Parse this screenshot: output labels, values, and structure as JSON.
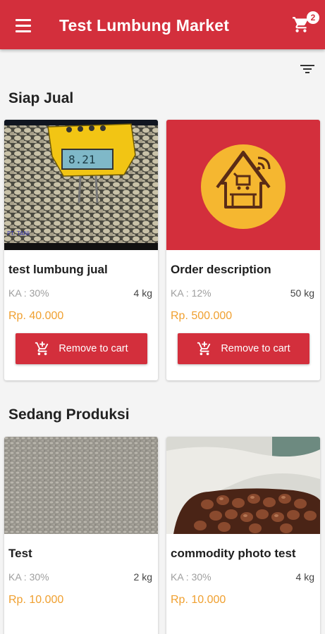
{
  "appbar": {
    "title": "Test Lumbung Market",
    "menu_icon": "hamburger-menu-icon",
    "cart_icon": "shopping-cart-icon",
    "cart_count": "2"
  },
  "filter_icon": "filter-list-icon",
  "colors": {
    "primary": "#d32f3c",
    "price": "#f0a030",
    "muted_text": "#9e9e9e",
    "logo_yellow": "#f5b730"
  },
  "sections": [
    {
      "title": "Siap Jual",
      "products": [
        {
          "name": "test lumbung jual",
          "ka": "KA : 30%",
          "weight": "4 kg",
          "price": "Rp. 40.000",
          "action_label": "Remove to cart",
          "image": "seeds-with-moisture-meter-photo"
        },
        {
          "name": "Order description",
          "ka": "KA : 12%",
          "weight": "50 kg",
          "price": "Rp. 500.000",
          "action_label": "Remove to cart",
          "image": "lumbung-logo-placeholder"
        }
      ]
    },
    {
      "title": "Sedang Produksi",
      "products": [
        {
          "name": "Test",
          "ka": "KA : 30%",
          "weight": "2 kg",
          "price": "Rp. 10.000",
          "image": "grain-texture-photo"
        },
        {
          "name": "commodity photo test",
          "ka": "KA : 30%",
          "weight": "4 kg",
          "price": "Rp. 10.000",
          "image": "nuts-in-sack-photo"
        }
      ]
    }
  ]
}
